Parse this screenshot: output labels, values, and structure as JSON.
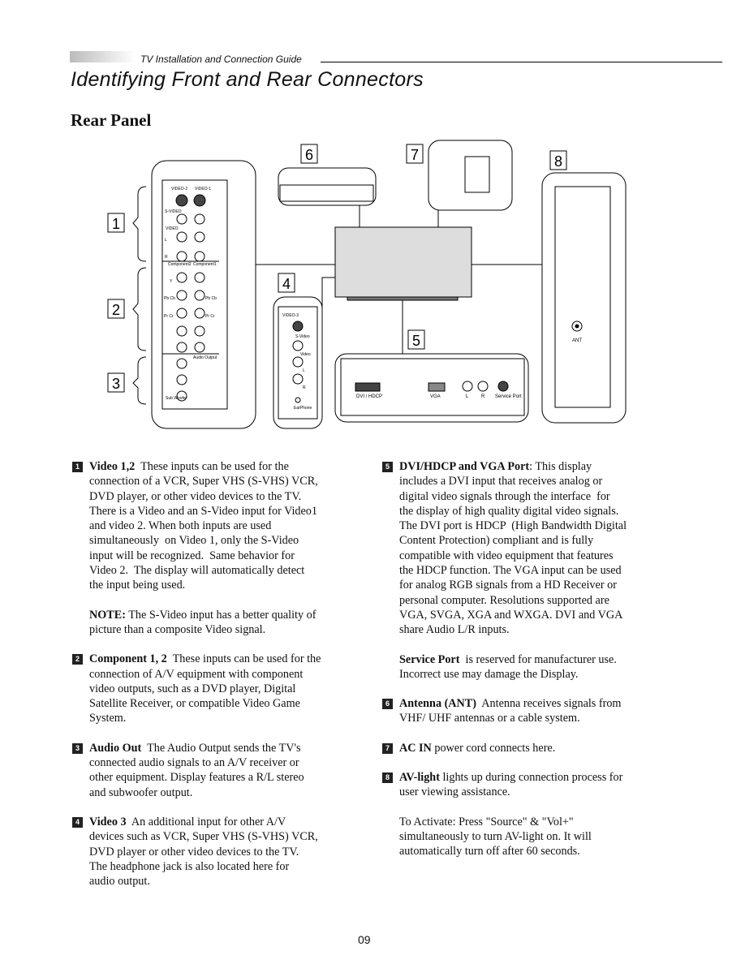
{
  "header": {
    "guide_title": "TV Installation and Connection Guide"
  },
  "page_title": "Identifying Front and Rear Connectors",
  "section_title": "Rear Panel",
  "diagram": {
    "callouts": [
      "1",
      "2",
      "3",
      "4",
      "5",
      "6",
      "7",
      "8"
    ],
    "panel_left": {
      "video_heads": [
        "VIDEO-2",
        "VIDEO-1"
      ],
      "svideo": "S-VIDEO",
      "video": "VIDEO",
      "l": "L",
      "r": "R",
      "comp_heads": [
        "Component2",
        "Component1"
      ],
      "y": "Y",
      "pb": "Pb Cb",
      "pr": "Pr Cr",
      "audio_output": "Audio Output",
      "sub": "Sub Woofer"
    },
    "panel_video3": {
      "title": "VIDEO-3",
      "svideo": "S-Video",
      "video": "Video",
      "l": "L",
      "r": "R",
      "ear": "EarPhone"
    },
    "panel_bottom": {
      "dvi": "DVI / HDCP",
      "vga": "VGA",
      "l": "L",
      "r": "R",
      "service": "Service Port"
    },
    "panel_right": {
      "ant": "ANT"
    }
  },
  "left_column": [
    {
      "num": "1",
      "lines": [
        [
          "Video 1,2",
          "  These inputs can be used for the"
        ],
        [
          "",
          "connection of a VCR, Super VHS (S-VHS) VCR,"
        ],
        [
          "",
          "DVD player, or other video devices to the TV."
        ],
        [
          "",
          "There is a Video and an S-Video input for Video1"
        ],
        [
          "",
          "and video 2. When both inputs are used"
        ],
        [
          "",
          "simultaneously  on Video 1, only the S-Video"
        ],
        [
          "",
          "input will be recognized.  Same behavior for"
        ],
        [
          "",
          "Video 2.  The display will automatically detect"
        ],
        [
          "",
          "the input being used."
        ]
      ]
    },
    {
      "num": "",
      "lines": [
        [
          "NOTE:",
          " The S-Video input has a better quality of"
        ],
        [
          "",
          "picture than a composite Video signal."
        ]
      ]
    },
    {
      "num": "2",
      "lines": [
        [
          "Component 1, 2",
          "  These inputs can be used for the"
        ],
        [
          "",
          "connection of A/V equipment with component"
        ],
        [
          "",
          "video outputs, such as a DVD player, Digital"
        ],
        [
          "",
          "Satellite Receiver, or compatible Video Game"
        ],
        [
          "",
          "System."
        ]
      ]
    },
    {
      "num": "3",
      "lines": [
        [
          "Audio Out",
          "  The Audio Output sends the TV's"
        ],
        [
          "",
          "connected audio signals to an A/V receiver or"
        ],
        [
          "",
          "other equipment. Display features a R/L stereo"
        ],
        [
          "",
          "and subwoofer output."
        ]
      ]
    },
    {
      "num": "4",
      "lines": [
        [
          "Video 3",
          "  An additional input for other A/V"
        ],
        [
          "",
          "devices such as VCR, Super VHS (S-VHS) VCR,"
        ],
        [
          "",
          "DVD player or other video devices to the TV."
        ],
        [
          "",
          "The headphone jack is also located here for"
        ],
        [
          "",
          "audio output."
        ]
      ]
    }
  ],
  "right_column": [
    {
      "num": "5",
      "lines": [
        [
          "DVI/HDCP and VGA Port",
          ": This display"
        ],
        [
          "",
          "includes a DVI input that receives analog or"
        ],
        [
          "",
          "digital video signals through the interface  for"
        ],
        [
          "",
          "the display of high quality digital video signals."
        ],
        [
          "",
          "The DVI port is HDCP  (High Bandwidth Digital"
        ],
        [
          "",
          "Content Protection) compliant and is fully"
        ],
        [
          "",
          "compatible with video equipment that features"
        ],
        [
          "",
          "the HDCP function. The VGA input can be used"
        ],
        [
          "",
          "for analog RGB signals from a HD Receiver or"
        ],
        [
          "",
          "personal computer. Resolutions supported are"
        ],
        [
          "",
          "VGA, SVGA, XGA and WXGA. DVI and VGA"
        ],
        [
          "",
          "share Audio L/R inputs."
        ]
      ]
    },
    {
      "num": "",
      "lines": [
        [
          "Service Port",
          "  is reserved for manufacturer use."
        ],
        [
          "",
          "Incorrect use may damage the Display."
        ]
      ]
    },
    {
      "num": "6",
      "lines": [
        [
          "Antenna (ANT)",
          "  Antenna receives signals from"
        ],
        [
          "",
          "VHF/ UHF antennas or a cable system."
        ]
      ]
    },
    {
      "num": "7",
      "lines": [
        [
          "AC IN",
          " power cord connects here."
        ]
      ]
    },
    {
      "num": "8",
      "lines": [
        [
          "AV-light",
          " lights up during connection process for"
        ],
        [
          "",
          "user viewing assistance."
        ]
      ]
    },
    {
      "num": "",
      "lines": [
        [
          "",
          "To Activate: Press \"Source\" & \"Vol+\""
        ],
        [
          "",
          "simultaneously to turn AV-light on. It will"
        ],
        [
          "",
          "automatically turn off after 60 seconds."
        ]
      ]
    }
  ],
  "page_number": "09"
}
